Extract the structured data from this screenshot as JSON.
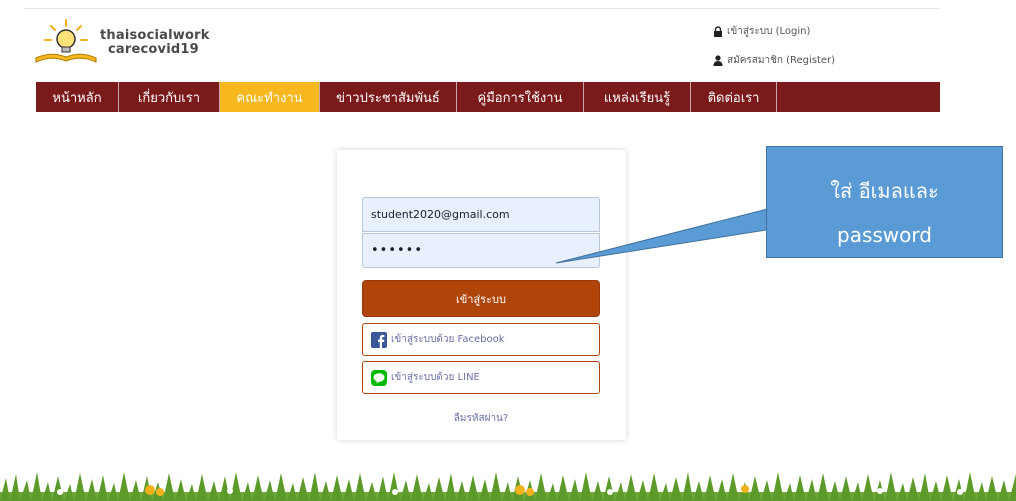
{
  "header": {
    "logo_line1": "thaisocialwork",
    "logo_line2": "carecovid19",
    "login_link": "เข้าสู่ระบบ (Login)",
    "register_link": "สมัครสมาชิก (Register)"
  },
  "nav": {
    "items": [
      {
        "label": "หน้าหลัก"
      },
      {
        "label": "เกี่ยวกับเรา"
      },
      {
        "label": "คณะทำงาน"
      },
      {
        "label": "ข่าวประชาสัมพันธ์"
      },
      {
        "label": "คู่มือการใช้งาน"
      },
      {
        "label": "แหล่งเรียนรู้"
      },
      {
        "label": "ติดต่อเรา"
      }
    ],
    "active_index": 2
  },
  "login": {
    "email_value": "student2020@gmail.com",
    "password_value": "••••••",
    "submit_label": "เข้าสู่ระบบ",
    "facebook_label": "เข้าสู่ระบบด้วย Facebook",
    "line_label": "เข้าสู่ระบบด้วย LINE",
    "forgot_label": "ลืมรหัสผ่าน?"
  },
  "callout": {
    "line1": "ใส่ อีเมลและ",
    "line2": "password"
  },
  "colors": {
    "nav_bg": "#7a1a1a",
    "nav_active": "#f6b81e",
    "button": "#b0450b",
    "callout": "#5b9bd5"
  }
}
